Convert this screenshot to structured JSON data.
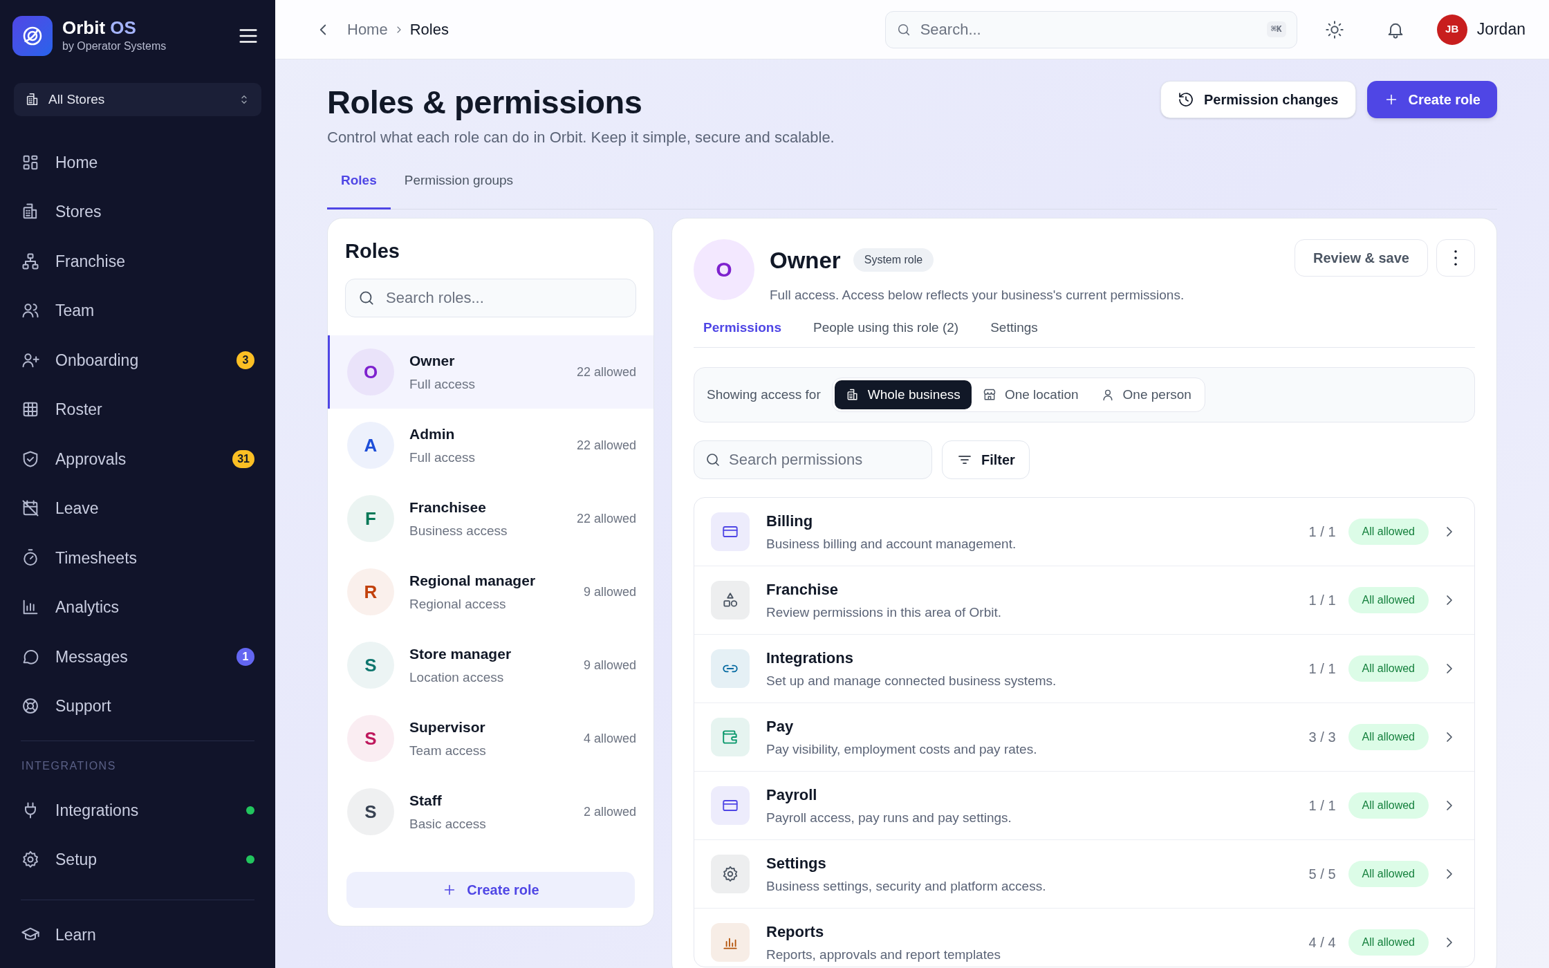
{
  "app": {
    "name": "Orbit",
    "name_accent": "OS",
    "tagline": "by Operator Systems"
  },
  "store_selector": {
    "value": "All Stores"
  },
  "nav": [
    {
      "label": "Home"
    },
    {
      "label": "Stores"
    },
    {
      "label": "Franchise"
    },
    {
      "label": "Team"
    },
    {
      "label": "Onboarding",
      "badge": "3",
      "color": "#fbbf24"
    },
    {
      "label": "Roster"
    },
    {
      "label": "Approvals",
      "badge": "31",
      "color": "#fbbf24"
    },
    {
      "label": "Leave"
    },
    {
      "label": "Timesheets"
    },
    {
      "label": "Analytics"
    },
    {
      "label": "Messages",
      "badge": "1",
      "color": "#6366f1"
    },
    {
      "label": "Support"
    }
  ],
  "integrations_section": {
    "heading": "INTEGRATIONS",
    "items": [
      {
        "label": "Integrations",
        "color": "#22c55e"
      },
      {
        "label": "Setup",
        "color": "#22c55e"
      }
    ]
  },
  "footer_nav": [
    {
      "label": "Learn"
    }
  ],
  "breadcrumb": [
    "Home",
    "Roles"
  ],
  "search": {
    "placeholder": "Search...",
    "shortcut": "⌘K"
  },
  "user": {
    "initials": "JB",
    "name": "Jordan"
  },
  "page": {
    "title": "Roles & permissions",
    "subtitle": "Control what each role can do in Orbit. Keep it simple, secure and scalable.",
    "buttons": [
      "Permission changes",
      "Create role"
    ]
  },
  "tabs": [
    {
      "label": "Roles",
      "selected": true
    },
    {
      "label": "Permission groups",
      "selected": false
    }
  ],
  "roles_panel": {
    "title": "Roles",
    "search_placeholder": "Search roles...",
    "create_button": "Create role",
    "roles": [
      {
        "initial": "O",
        "name": "Owner",
        "description": "Full access",
        "count": "22 allowed",
        "color": "#7e22ce",
        "selected": true
      },
      {
        "initial": "A",
        "name": "Admin",
        "description": "Full access",
        "count": "22 allowed",
        "color": "#1d4ed8",
        "selected": false
      },
      {
        "initial": "F",
        "name": "Franchisee",
        "description": "Business access",
        "count": "22 allowed",
        "color": "#047857",
        "selected": false
      },
      {
        "initial": "R",
        "name": "Regional manager",
        "description": "Regional access",
        "count": "9 allowed",
        "color": "#c2410c",
        "selected": false
      },
      {
        "initial": "S",
        "name": "Store manager",
        "description": "Location access",
        "count": "9 allowed",
        "color": "#0f766e",
        "selected": false
      },
      {
        "initial": "S",
        "name": "Supervisor",
        "description": "Team access",
        "count": "4 allowed",
        "color": "#be185d",
        "selected": false
      },
      {
        "initial": "S",
        "name": "Staff",
        "description": "Basic access",
        "count": "2 allowed",
        "color": "#374151",
        "selected": false
      }
    ]
  },
  "role_detail": {
    "initial": "O",
    "name": "Owner",
    "badge": "System role",
    "description": "Full access. Access below reflects your business's current permissions.",
    "review_button": "Review & save",
    "tabs": [
      {
        "label": "Permissions",
        "selected": true
      },
      {
        "label": "People using this role (2)",
        "selected": false
      },
      {
        "label": "Settings",
        "selected": false
      }
    ],
    "scope_label": "Showing access for",
    "scopes": [
      {
        "label": "Whole business",
        "selected": true
      },
      {
        "label": "One location",
        "selected": false
      },
      {
        "label": "One person",
        "selected": false
      }
    ],
    "search_placeholder": "Search permissions",
    "filter_button": "Filter",
    "groups": [
      {
        "name": "Billing",
        "description": "Business billing and account management.",
        "count": "1 / 1",
        "status": "All allowed",
        "color": "#4f46e5"
      },
      {
        "name": "Franchise",
        "description": "Review permissions in this area of Orbit.",
        "count": "1 / 1",
        "status": "All allowed",
        "color": "#4b5563"
      },
      {
        "name": "Integrations",
        "description": "Set up and manage connected business systems.",
        "count": "1 / 1",
        "status": "All allowed",
        "color": "#0369a1"
      },
      {
        "name": "Pay",
        "description": "Pay visibility, employment costs and pay rates.",
        "count": "3 / 3",
        "status": "All allowed",
        "color": "#059669"
      },
      {
        "name": "Payroll",
        "description": "Payroll access, pay runs and pay settings.",
        "count": "1 / 1",
        "status": "All allowed",
        "color": "#4f46e5"
      },
      {
        "name": "Settings",
        "description": "Business settings, security and platform access.",
        "count": "5 / 5",
        "status": "All allowed",
        "color": "#4b5563"
      },
      {
        "name": "Reports",
        "description": "Reports, approvals and report templates",
        "count": "4 / 4",
        "status": "All allowed",
        "color": "#b45309"
      }
    ]
  }
}
